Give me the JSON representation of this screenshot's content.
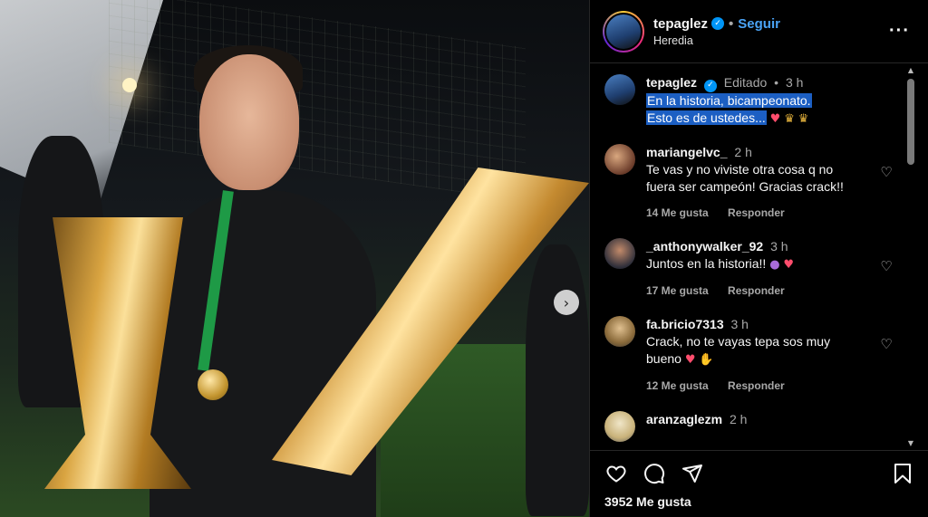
{
  "post": {
    "author": "tepaglez",
    "location": "Heredia",
    "follow_label": "Seguir",
    "caption_line1": "En la historia, bicampeonato.",
    "caption_line2": "Esto es de ustedes...",
    "caption_edited": "Editado",
    "caption_time": "3 h",
    "likes_text": "3952 Me gusta"
  },
  "comments": [
    {
      "user": "mariangelvc_",
      "time": "2 h",
      "text_line1": "Te vas y no viviste otra cosa q no",
      "text_line2": "fuera ser campeón! Gracias crack!!",
      "likes": "14 Me gusta",
      "reply": "Responder"
    },
    {
      "user": "_anthonywalker_92",
      "time": "3 h",
      "text_line1": "Juntos en la historia!!",
      "likes": "17 Me gusta",
      "reply": "Responder"
    },
    {
      "user": "fa.bricio7313",
      "time": "3 h",
      "text_line1": "Crack, no te vayas tepa sos muy",
      "text_line2": "bueno",
      "likes": "12 Me gusta",
      "reply": "Responder"
    },
    {
      "user": "aranzaglezm",
      "time": "2 h"
    }
  ],
  "icons": {
    "more": "more-options-icon",
    "like": "heart-icon",
    "comment": "comment-icon",
    "share": "send-icon",
    "save": "bookmark-icon",
    "next": "chevron-right-icon"
  },
  "colors": {
    "background": "#000000",
    "accent": "#0095f6",
    "follow": "#4aa3f5",
    "selection": "#1c5fc3"
  }
}
